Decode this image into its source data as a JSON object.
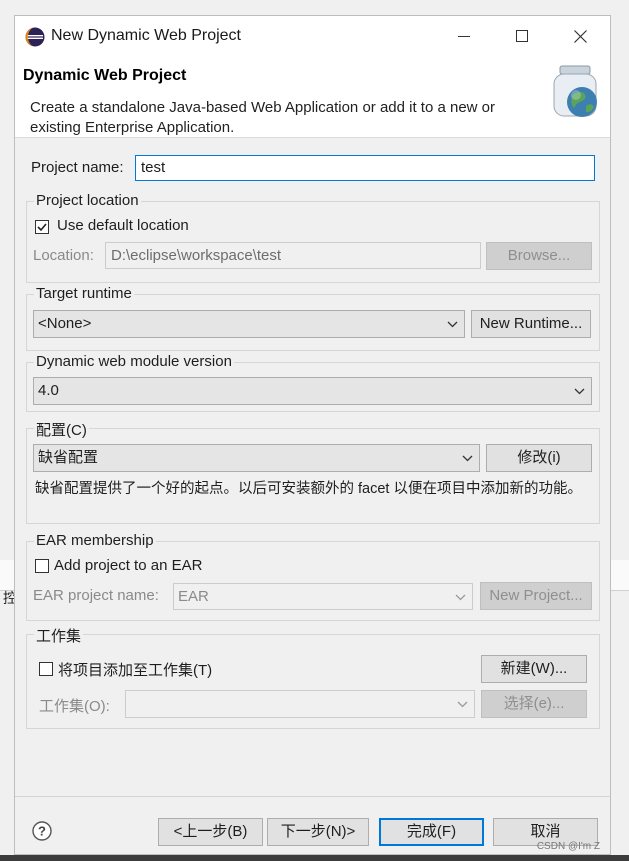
{
  "background": {
    "left_fragment": "控"
  },
  "window": {
    "title": "New Dynamic Web Project",
    "minimize_icon": "minimize-icon",
    "maximize_icon": "maximize-icon",
    "close_icon": "close-icon"
  },
  "banner": {
    "title": "Dynamic Web Project",
    "description": "Create a standalone Java-based Web Application or add it to a new or existing Enterprise Application."
  },
  "project_name": {
    "label": "Project name:",
    "value": "test"
  },
  "project_location": {
    "group_label": "Project location",
    "use_default_label": "Use default location",
    "use_default_checked": true,
    "location_label": "Location:",
    "location_value": "D:\\eclipse\\workspace\\test",
    "browse_label": "Browse..."
  },
  "target_runtime": {
    "group_label": "Target runtime",
    "selected": "<None>",
    "new_runtime_label": "New Runtime..."
  },
  "module_version": {
    "group_label": "Dynamic web module version",
    "selected": "4.0"
  },
  "configuration": {
    "group_label": "配置(C)",
    "selected": "缺省配置",
    "modify_label": "修改(i)",
    "description": "缺省配置提供了一个好的起点。以后可安装额外的 facet 以便在项目中添加新的功能。"
  },
  "ear": {
    "group_label": "EAR membership",
    "add_label": "Add project to an EAR",
    "add_checked": false,
    "name_label": "EAR project name:",
    "name_value": "EAR",
    "new_project_label": "New Project..."
  },
  "working_sets": {
    "group_label": "工作集",
    "add_label": "将项目添加至工作集(T)",
    "add_checked": false,
    "new_label": "新建(W)...",
    "set_label": "工作集(O):",
    "select_label": "选择(e)..."
  },
  "footer": {
    "help_icon": "help-icon",
    "back_label": "<上一步(B)",
    "next_label": "下一步(N)>",
    "finish_label": "完成(F)",
    "cancel_label": "取消",
    "watermark": "CSDN @I'm   Z"
  },
  "colors": {
    "focus_border": "#0078d7",
    "dialog_bg": "#f0f0f0",
    "banner_bg": "#ffffff"
  }
}
